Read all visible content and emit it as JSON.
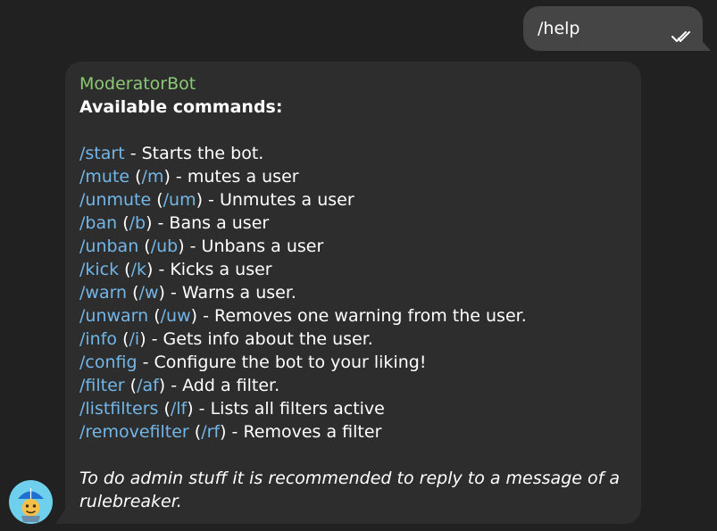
{
  "outgoing": {
    "text": "/help",
    "status_icon": "double-check-icon"
  },
  "incoming": {
    "sender": "ModeratorBot",
    "heading": "Available commands:",
    "commands": [
      {
        "cmd": "/start",
        "alias": "",
        "desc": " - Starts the bot."
      },
      {
        "cmd": "/mute",
        "alias": "/m",
        "desc": ") - mutes a user"
      },
      {
        "cmd": "/unmute",
        "alias": "/um",
        "desc": ") - Unmutes a user"
      },
      {
        "cmd": "/ban",
        "alias": "/b",
        "desc": ") - Bans a user"
      },
      {
        "cmd": "/unban",
        "alias": "/ub",
        "desc": ") - Unbans a user"
      },
      {
        "cmd": "/kick",
        "alias": "/k",
        "desc": ") - Kicks a user"
      },
      {
        "cmd": "/warn",
        "alias": "/w",
        "desc": ") - Warns a user."
      },
      {
        "cmd": "/unwarn",
        "alias": "/uw",
        "desc": ") - Removes one warning from the user."
      },
      {
        "cmd": "/info",
        "alias": "/i",
        "desc": ") - Gets info about the user."
      },
      {
        "cmd": "/config",
        "alias": "",
        "desc": " - Configure the bot to your liking!"
      },
      {
        "cmd": "/filter",
        "alias": "/af",
        "desc": ") - Add a filter."
      },
      {
        "cmd": "/listfilters",
        "alias": "/lf",
        "desc": ") - Lists all filters active"
      },
      {
        "cmd": "/removefilter",
        "alias": "/rf",
        "desc": ") - Removes a filter"
      }
    ],
    "note": "To do admin stuff it is recommended to reply to a message of a rulebreaker."
  },
  "avatar": {
    "icon": "bot-avatar-icon"
  },
  "colors": {
    "background": "#212121",
    "incoming_bubble": "#2d2d2d",
    "outgoing_bubble": "#454545",
    "sender": "#8bc974",
    "command_link": "#73b6e8"
  }
}
